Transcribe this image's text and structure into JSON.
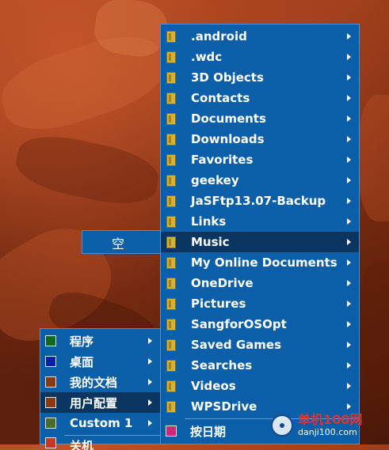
{
  "folder_menu": {
    "items": [
      {
        "label": ".android"
      },
      {
        "label": ".wdc"
      },
      {
        "label": "3D Objects"
      },
      {
        "label": "Contacts"
      },
      {
        "label": "Documents"
      },
      {
        "label": "Downloads"
      },
      {
        "label": "Favorites"
      },
      {
        "label": "geekey"
      },
      {
        "label": "JaSFtp13.07-Backup"
      },
      {
        "label": "Links"
      },
      {
        "label": "Music",
        "selected": true
      },
      {
        "label": "My Online Documents"
      },
      {
        "label": "OneDrive"
      },
      {
        "label": "Pictures"
      },
      {
        "label": "SangforOSOpt"
      },
      {
        "label": "Saved Games"
      },
      {
        "label": "Searches"
      },
      {
        "label": "Videos"
      },
      {
        "label": "WPSDrive"
      }
    ],
    "sort_by_date_label": "按日期",
    "sort_icon_color": "#d4237a"
  },
  "empty_menu": {
    "label": "空"
  },
  "main_menu": {
    "items": [
      {
        "label": "程序",
        "color": "#0a6b1f"
      },
      {
        "label": "桌面",
        "color": "#0a1fa8"
      },
      {
        "label": "我的文档",
        "color": "#8a3a12"
      },
      {
        "label": "用户配置",
        "color": "#8a3a12",
        "selected": true
      },
      {
        "label": "Custom 1",
        "color": "#4a6b2a"
      }
    ],
    "partial_label": "关机",
    "partial_color": "#c0392b"
  },
  "watermark": {
    "name": "单机100网",
    "url": "danji100.com"
  }
}
